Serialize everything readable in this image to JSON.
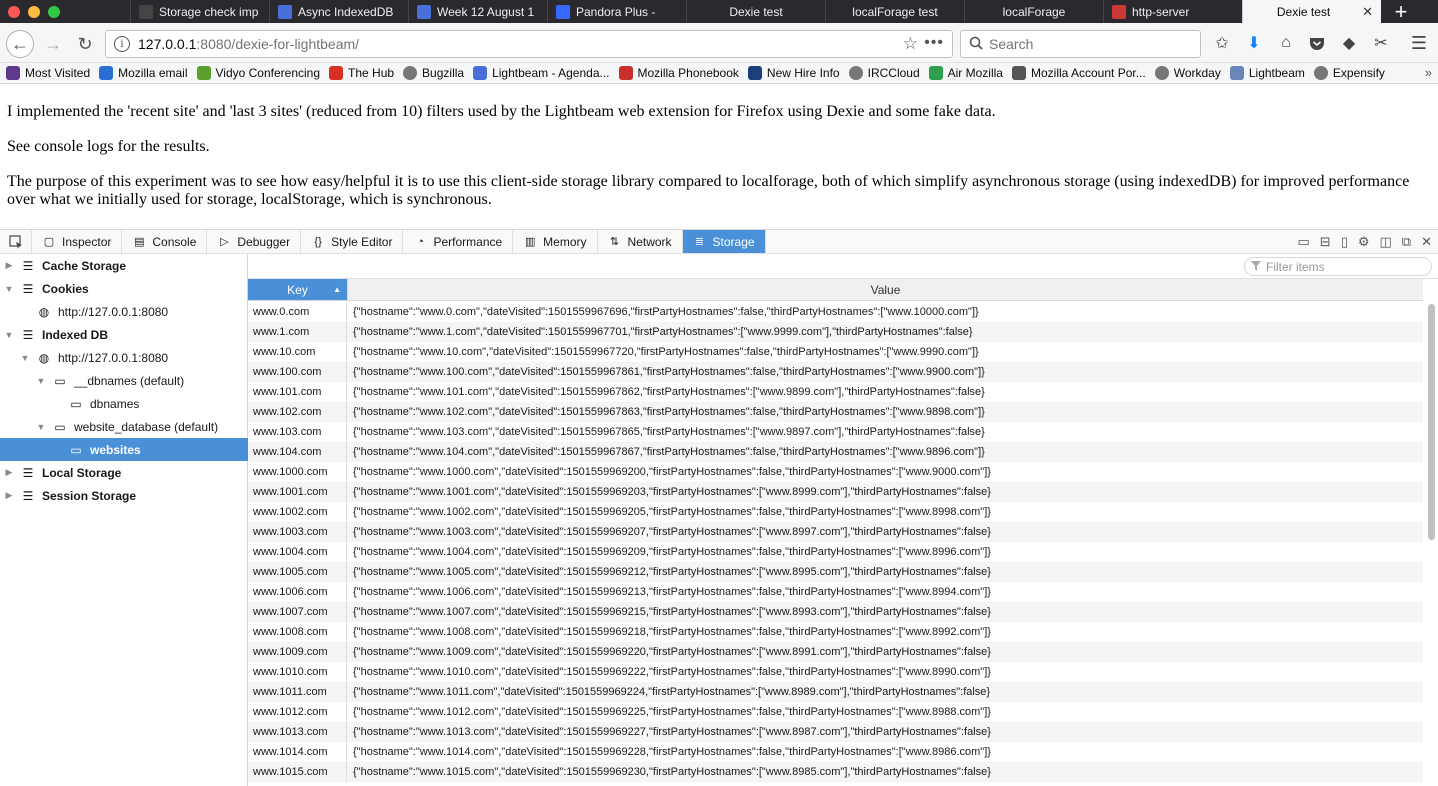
{
  "tabs": [
    {
      "label": "Storage check imp",
      "icon": "github-icon",
      "color": "#444"
    },
    {
      "label": "Async IndexedDB",
      "icon": "doc-icon",
      "color": "#4a6fd8"
    },
    {
      "label": "Week 12 August 1",
      "icon": "doc-icon",
      "color": "#4a6fd8"
    },
    {
      "label": "Pandora Plus -",
      "icon": "pandora-icon",
      "color": "#3668ff"
    },
    {
      "label": "Dexie test",
      "icon": "",
      "color": ""
    },
    {
      "label": "localForage test",
      "icon": "",
      "color": ""
    },
    {
      "label": "localForage",
      "icon": "",
      "color": ""
    },
    {
      "label": "http-server",
      "icon": "npm-icon",
      "color": "#cb3837"
    },
    {
      "label": "Dexie test",
      "icon": "",
      "color": "",
      "active": true
    }
  ],
  "url": {
    "host": "127.0.0.1",
    "path": ":8080/dexie-for-lightbeam/"
  },
  "search_placeholder": "Search",
  "bookmarks": [
    {
      "label": "Most Visited",
      "icon": "most-visited-icon",
      "color": "#5e3a8c"
    },
    {
      "label": "Mozilla email",
      "icon": "mozilla-email-icon",
      "color": "#2a6fd6"
    },
    {
      "label": "Vidyo Conferencing",
      "icon": "vidyo-icon",
      "color": "#5aa02c"
    },
    {
      "label": "The Hub",
      "icon": "hub-icon",
      "color": "#d93025"
    },
    {
      "label": "Bugzilla",
      "icon": "globe-icon",
      "color": "#777"
    },
    {
      "label": "Lightbeam - Agenda...",
      "icon": "doc-icon",
      "color": "#4a6fd8"
    },
    {
      "label": "Mozilla Phonebook",
      "icon": "phonebook-icon",
      "color": "#c9302c"
    },
    {
      "label": "New Hire Info",
      "icon": "newhire-icon",
      "color": "#1c3f7a"
    },
    {
      "label": "IRCCloud",
      "icon": "globe-icon",
      "color": "#777"
    },
    {
      "label": "Air Mozilla",
      "icon": "air-mozilla-icon",
      "color": "#2e9f4e"
    },
    {
      "label": "Mozilla Account Por...",
      "icon": "m-icon",
      "color": "#555"
    },
    {
      "label": "Workday",
      "icon": "globe-icon",
      "color": "#777"
    },
    {
      "label": "Lightbeam",
      "icon": "folder-icon",
      "color": "#6a86b8"
    },
    {
      "label": "Expensify",
      "icon": "globe-icon",
      "color": "#777"
    }
  ],
  "content": {
    "p1": "I implemented the 'recent site' and 'last 3 sites' (reduced from 10) filters used by the Lightbeam web extension for Firefox using Dexie and some fake data.",
    "p2": "See console logs for the results.",
    "p3": "The purpose of this experiment was to see how easy/helpful it is to use this client-side storage library compared to localforage, both of which simplify asynchronous storage (using indexedDB) for improved performance over what we initially used for storage, localStorage, which is synchronous."
  },
  "devtools": {
    "tabs": [
      {
        "label": "Inspector",
        "icon": "inspector-icon"
      },
      {
        "label": "Console",
        "icon": "console-icon"
      },
      {
        "label": "Debugger",
        "icon": "debugger-icon"
      },
      {
        "label": "Style Editor",
        "icon": "style-editor-icon"
      },
      {
        "label": "Performance",
        "icon": "performance-icon"
      },
      {
        "label": "Memory",
        "icon": "memory-icon"
      },
      {
        "label": "Network",
        "icon": "network-icon"
      },
      {
        "label": "Storage",
        "icon": "storage-icon",
        "active": true
      }
    ],
    "filter_placeholder": "Filter items",
    "tree": [
      {
        "label": "Cache Storage",
        "level": 0,
        "bold": true,
        "twisty": "▶",
        "icon": "db-icon"
      },
      {
        "label": "Cookies",
        "level": 0,
        "bold": true,
        "twisty": "▼",
        "icon": "db-icon"
      },
      {
        "label": "http://127.0.0.1:8080",
        "level": 1,
        "icon": "globe-icon"
      },
      {
        "label": "Indexed DB",
        "level": 0,
        "bold": true,
        "twisty": "▼",
        "icon": "db-icon"
      },
      {
        "label": "http://127.0.0.1:8080",
        "level": 1,
        "twisty": "▼",
        "icon": "globe-icon"
      },
      {
        "label": "__dbnames (default)",
        "level": 2,
        "twisty": "▼",
        "icon": "folder-icon"
      },
      {
        "label": "dbnames",
        "level": 3,
        "icon": "folder-icon"
      },
      {
        "label": "website_database (default)",
        "level": 2,
        "twisty": "▼",
        "icon": "folder-icon"
      },
      {
        "label": "websites",
        "level": 3,
        "icon": "folder-icon",
        "selected": true
      },
      {
        "label": "Local Storage",
        "level": 0,
        "bold": true,
        "twisty": "▶",
        "icon": "db-icon"
      },
      {
        "label": "Session Storage",
        "level": 0,
        "bold": true,
        "twisty": "▶",
        "icon": "db-icon"
      }
    ],
    "columns": {
      "key": "Key",
      "value": "Value"
    },
    "rows": [
      {
        "key": "www.0.com",
        "value": "{\"hostname\":\"www.0.com\",\"dateVisited\":1501559967696,\"firstPartyHostnames\":false,\"thirdPartyHostnames\":[\"www.10000.com\"]}"
      },
      {
        "key": "www.1.com",
        "value": "{\"hostname\":\"www.1.com\",\"dateVisited\":1501559967701,\"firstPartyHostnames\":[\"www.9999.com\"],\"thirdPartyHostnames\":false}"
      },
      {
        "key": "www.10.com",
        "value": "{\"hostname\":\"www.10.com\",\"dateVisited\":1501559967720,\"firstPartyHostnames\":false,\"thirdPartyHostnames\":[\"www.9990.com\"]}"
      },
      {
        "key": "www.100.com",
        "value": "{\"hostname\":\"www.100.com\",\"dateVisited\":1501559967861,\"firstPartyHostnames\":false,\"thirdPartyHostnames\":[\"www.9900.com\"]}"
      },
      {
        "key": "www.101.com",
        "value": "{\"hostname\":\"www.101.com\",\"dateVisited\":1501559967862,\"firstPartyHostnames\":[\"www.9899.com\"],\"thirdPartyHostnames\":false}"
      },
      {
        "key": "www.102.com",
        "value": "{\"hostname\":\"www.102.com\",\"dateVisited\":1501559967863,\"firstPartyHostnames\":false,\"thirdPartyHostnames\":[\"www.9898.com\"]}"
      },
      {
        "key": "www.103.com",
        "value": "{\"hostname\":\"www.103.com\",\"dateVisited\":1501559967865,\"firstPartyHostnames\":[\"www.9897.com\"],\"thirdPartyHostnames\":false}"
      },
      {
        "key": "www.104.com",
        "value": "{\"hostname\":\"www.104.com\",\"dateVisited\":1501559967867,\"firstPartyHostnames\":false,\"thirdPartyHostnames\":[\"www.9896.com\"]}"
      },
      {
        "key": "www.1000.com",
        "value": "{\"hostname\":\"www.1000.com\",\"dateVisited\":1501559969200,\"firstPartyHostnames\":false,\"thirdPartyHostnames\":[\"www.9000.com\"]}"
      },
      {
        "key": "www.1001.com",
        "value": "{\"hostname\":\"www.1001.com\",\"dateVisited\":1501559969203,\"firstPartyHostnames\":[\"www.8999.com\"],\"thirdPartyHostnames\":false}"
      },
      {
        "key": "www.1002.com",
        "value": "{\"hostname\":\"www.1002.com\",\"dateVisited\":1501559969205,\"firstPartyHostnames\":false,\"thirdPartyHostnames\":[\"www.8998.com\"]}"
      },
      {
        "key": "www.1003.com",
        "value": "{\"hostname\":\"www.1003.com\",\"dateVisited\":1501559969207,\"firstPartyHostnames\":[\"www.8997.com\"],\"thirdPartyHostnames\":false}"
      },
      {
        "key": "www.1004.com",
        "value": "{\"hostname\":\"www.1004.com\",\"dateVisited\":1501559969209,\"firstPartyHostnames\":false,\"thirdPartyHostnames\":[\"www.8996.com\"]}"
      },
      {
        "key": "www.1005.com",
        "value": "{\"hostname\":\"www.1005.com\",\"dateVisited\":1501559969212,\"firstPartyHostnames\":[\"www.8995.com\"],\"thirdPartyHostnames\":false}"
      },
      {
        "key": "www.1006.com",
        "value": "{\"hostname\":\"www.1006.com\",\"dateVisited\":1501559969213,\"firstPartyHostnames\":false,\"thirdPartyHostnames\":[\"www.8994.com\"]}"
      },
      {
        "key": "www.1007.com",
        "value": "{\"hostname\":\"www.1007.com\",\"dateVisited\":1501559969215,\"firstPartyHostnames\":[\"www.8993.com\"],\"thirdPartyHostnames\":false}"
      },
      {
        "key": "www.1008.com",
        "value": "{\"hostname\":\"www.1008.com\",\"dateVisited\":1501559969218,\"firstPartyHostnames\":false,\"thirdPartyHostnames\":[\"www.8992.com\"]}"
      },
      {
        "key": "www.1009.com",
        "value": "{\"hostname\":\"www.1009.com\",\"dateVisited\":1501559969220,\"firstPartyHostnames\":[\"www.8991.com\"],\"thirdPartyHostnames\":false}"
      },
      {
        "key": "www.1010.com",
        "value": "{\"hostname\":\"www.1010.com\",\"dateVisited\":1501559969222,\"firstPartyHostnames\":false,\"thirdPartyHostnames\":[\"www.8990.com\"]}"
      },
      {
        "key": "www.1011.com",
        "value": "{\"hostname\":\"www.1011.com\",\"dateVisited\":1501559969224,\"firstPartyHostnames\":[\"www.8989.com\"],\"thirdPartyHostnames\":false}"
      },
      {
        "key": "www.1012.com",
        "value": "{\"hostname\":\"www.1012.com\",\"dateVisited\":1501559969225,\"firstPartyHostnames\":false,\"thirdPartyHostnames\":[\"www.8988.com\"]}"
      },
      {
        "key": "www.1013.com",
        "value": "{\"hostname\":\"www.1013.com\",\"dateVisited\":1501559969227,\"firstPartyHostnames\":[\"www.8987.com\"],\"thirdPartyHostnames\":false}"
      },
      {
        "key": "www.1014.com",
        "value": "{\"hostname\":\"www.1014.com\",\"dateVisited\":1501559969228,\"firstPartyHostnames\":false,\"thirdPartyHostnames\":[\"www.8986.com\"]}"
      },
      {
        "key": "www.1015.com",
        "value": "{\"hostname\":\"www.1015.com\",\"dateVisited\":1501559969230,\"firstPartyHostnames\":[\"www.8985.com\"],\"thirdPartyHostnames\":false}"
      }
    ]
  },
  "colors": {
    "accent": "#4a90d9",
    "tabstrip": "#2a2a2e"
  }
}
